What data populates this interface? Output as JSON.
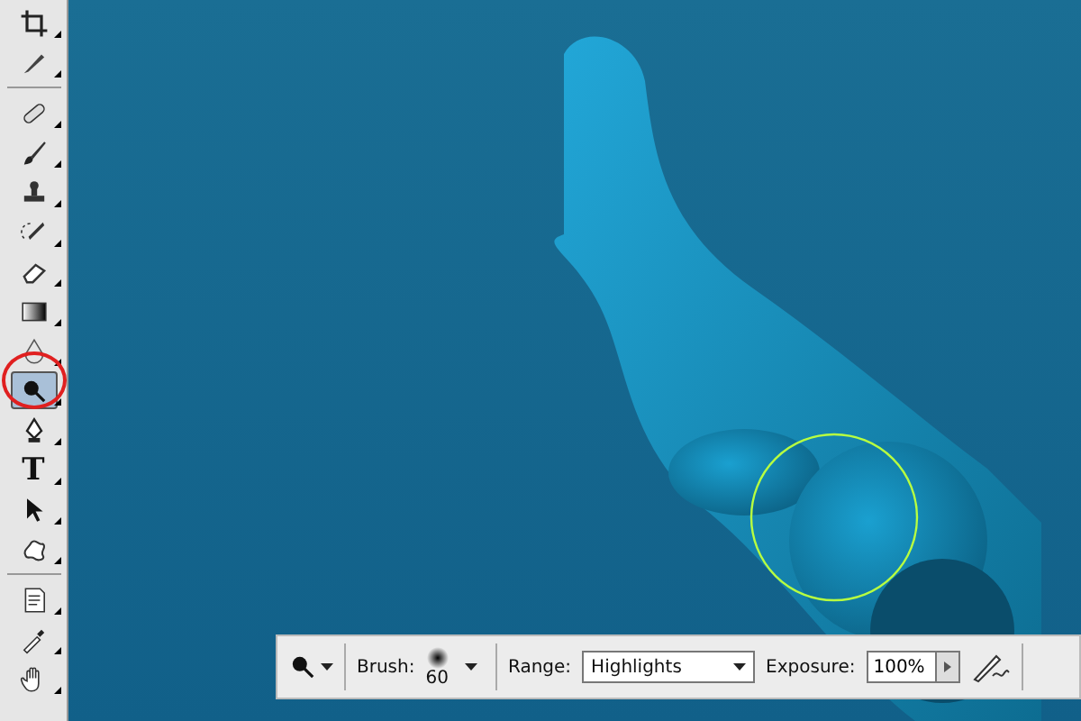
{
  "toolbox": {
    "tools": [
      {
        "kind": "crop",
        "selected": false
      },
      {
        "kind": "slice",
        "selected": false
      },
      {
        "kind": "healing",
        "selected": false
      },
      {
        "kind": "brush",
        "selected": false
      },
      {
        "kind": "stamp",
        "selected": false
      },
      {
        "kind": "history",
        "selected": false
      },
      {
        "kind": "eraser",
        "selected": false
      },
      {
        "kind": "gradient",
        "selected": false
      },
      {
        "kind": "blur",
        "selected": false
      },
      {
        "kind": "dodge",
        "selected": true
      },
      {
        "kind": "pen",
        "selected": false
      },
      {
        "kind": "type",
        "glyph": "T",
        "selected": false
      },
      {
        "kind": "select",
        "selected": false
      },
      {
        "kind": "shape",
        "selected": false
      },
      {
        "kind": "notes",
        "selected": false
      },
      {
        "kind": "eyedropper",
        "selected": false
      },
      {
        "kind": "hand",
        "selected": false
      }
    ]
  },
  "options_bar": {
    "brush_label": "Brush:",
    "brush_size": "60",
    "range_label": "Range:",
    "range_value": "Highlights",
    "exposure_label": "Exposure:",
    "exposure_value": "100%"
  }
}
